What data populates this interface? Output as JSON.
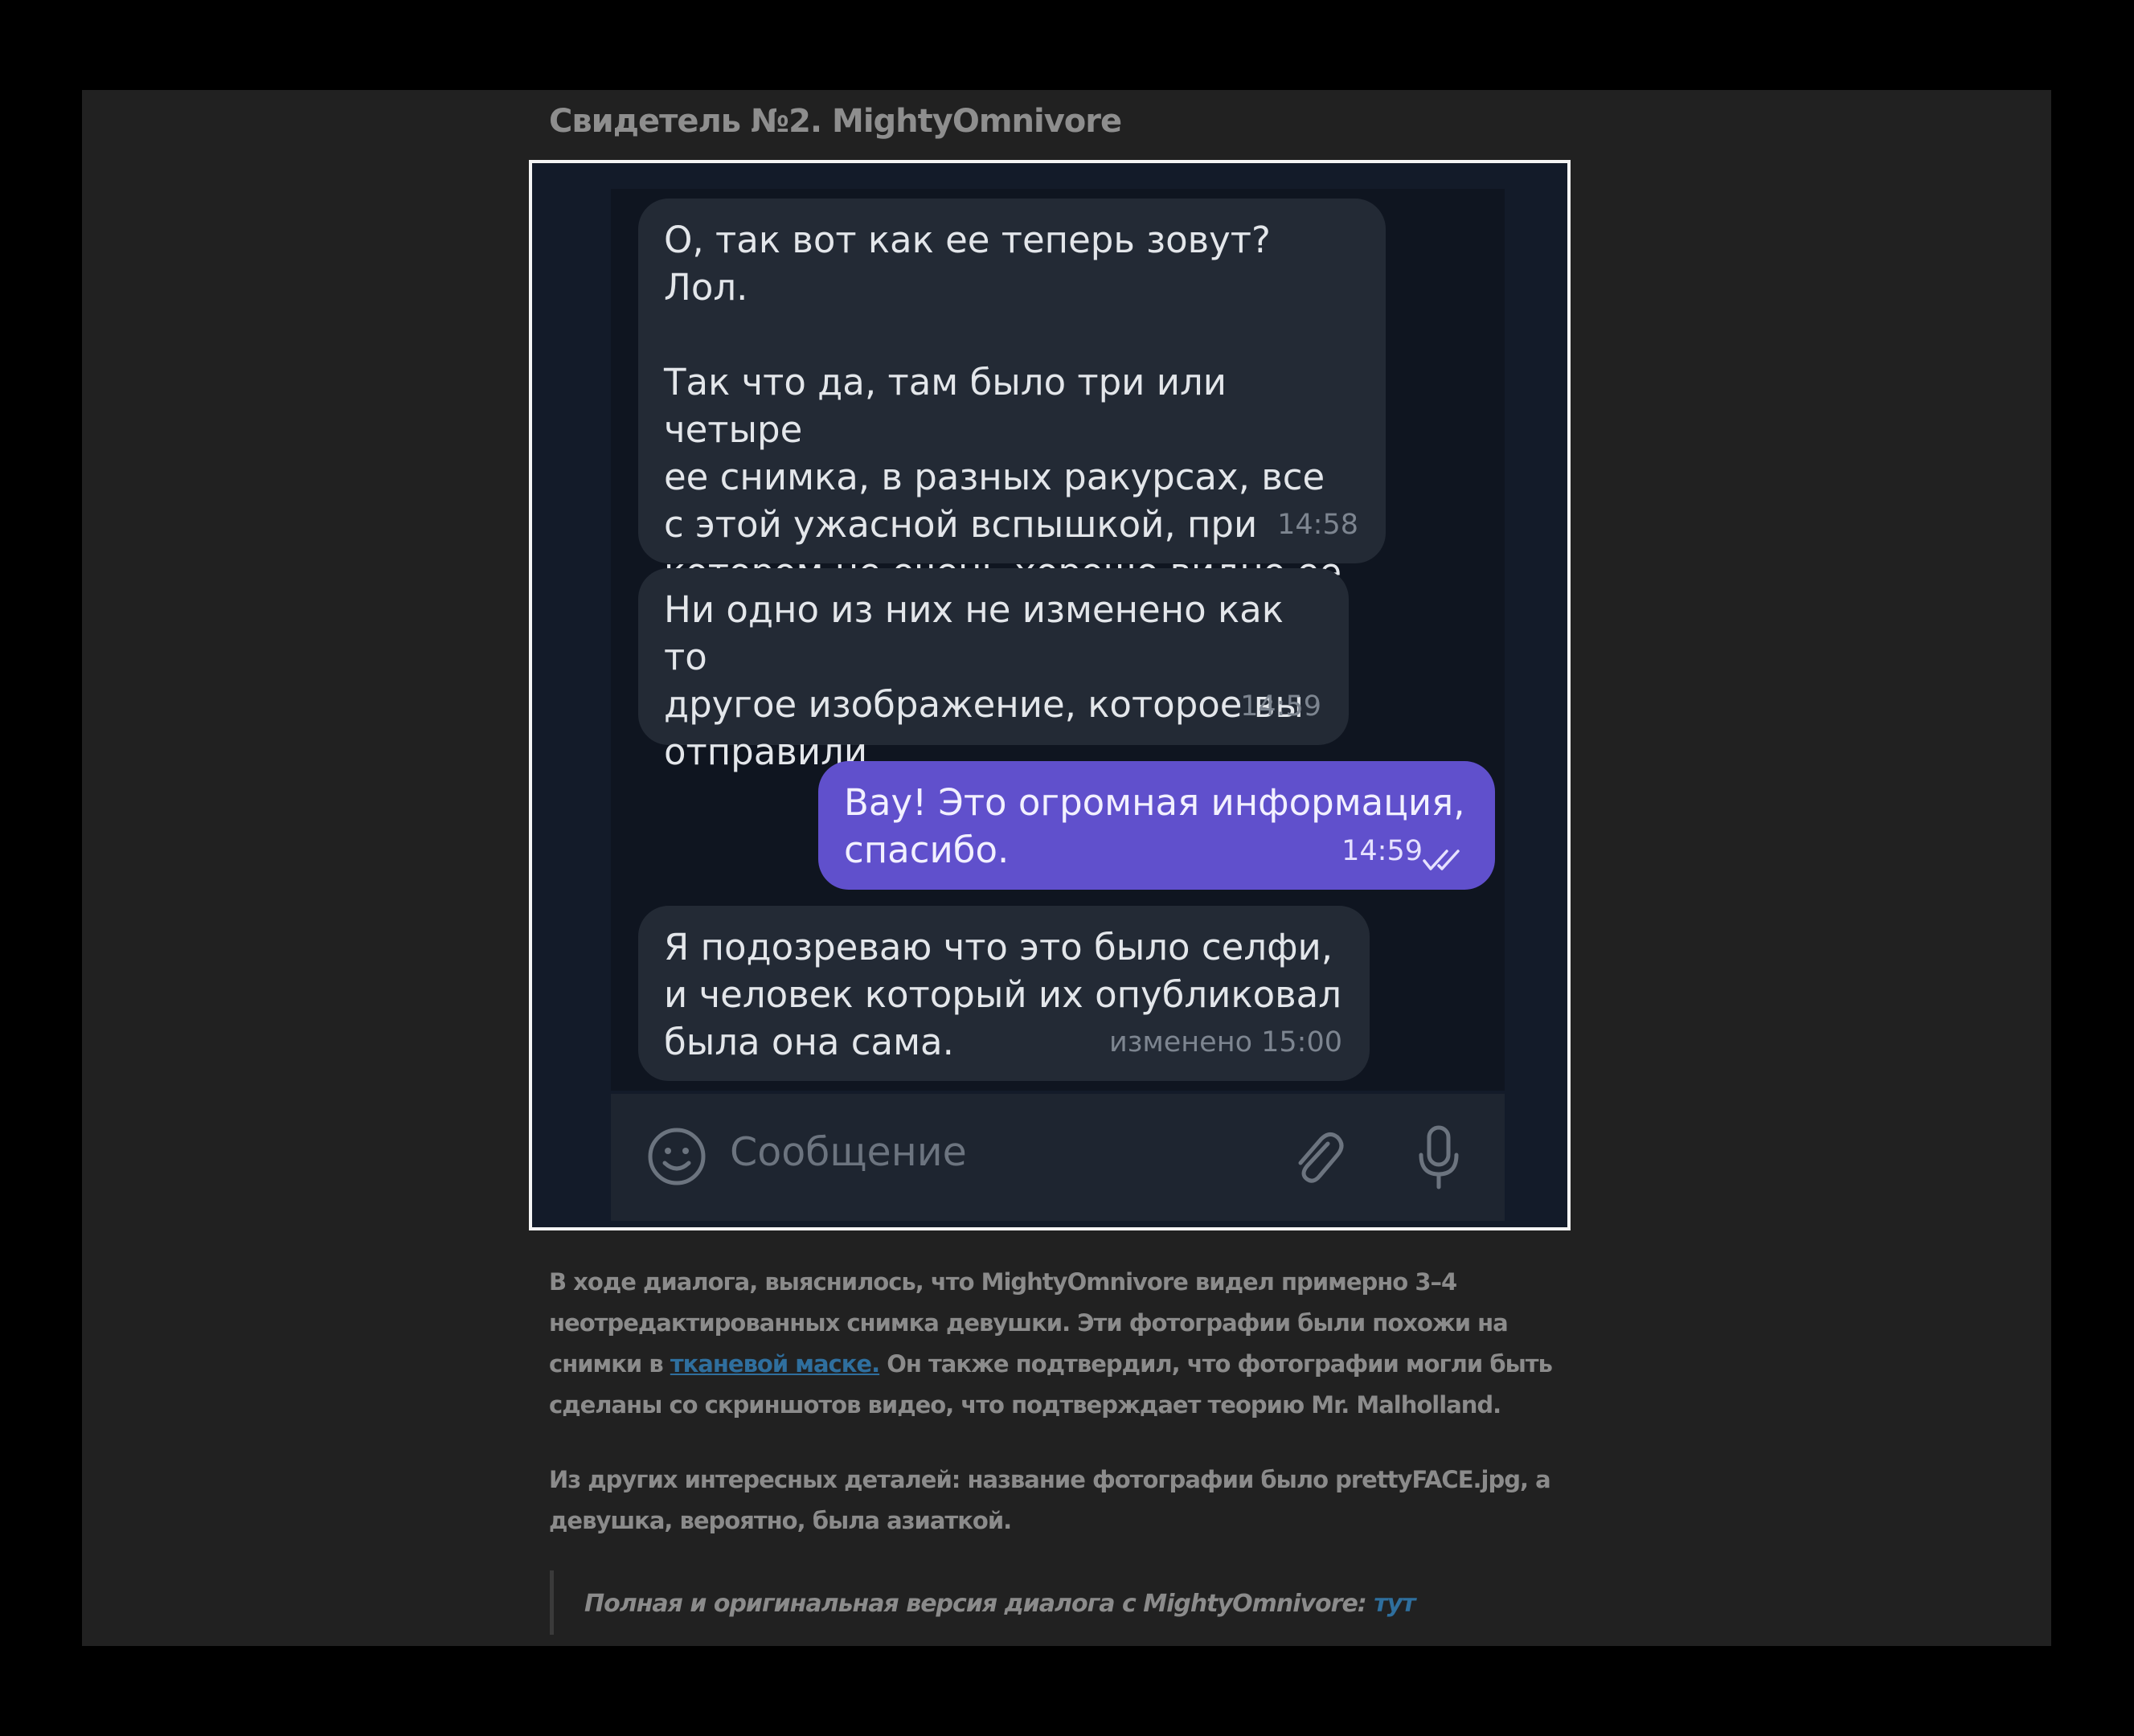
{
  "heading": "Свидетель №2. MightyOmnivore",
  "chat": {
    "messages": [
      {
        "text": "О, так вот как ее теперь зовут? Лол.\n\nТак что да, там было три или четыре\nее снимка, в разных ракурсах, все\nс этой ужасной вспышкой, при\nкотором не очень хорошо видно ее\nлицо.",
        "time": "14:58"
      },
      {
        "text": "Ни одно из них не изменено как то\nдругое изображение, которое вы\nотправили",
        "time": "14:59"
      },
      {
        "text": "Вау! Это огромная информация,\nспасибо.",
        "time": "14:59"
      },
      {
        "text": "Я подозреваю что это было селфи,\nи человек который их опубликовал\nбыла она сама.",
        "time": "изменено 15:00"
      }
    ],
    "input_placeholder": "Сообщение"
  },
  "article": {
    "p1_part1": "В ходе диалога, выяснилось, что MightyOmnivore видел примерно 3–4 неотредактированных снимка девушки. Эти фотографии были похожи на снимки в ",
    "p1_link": "тканевой маске.",
    "p1_part2": " Он также подтвердил, что фотографии могли быть сделаны со скриншотов видео, что подтверждает теорию Mr. Malholland.",
    "p2": "Из других интересных деталей: название фотографии было prettyFACE.jpg, а девушка, вероятно, была азиаткой.",
    "quote_text": "Полная и оригинальная версия диалога с MightyOmnivore: ",
    "quote_link": "тут"
  },
  "colors": {
    "page_bg": "#212121",
    "chat_bg": "#0f1520",
    "incoming_bubble": "#232a35",
    "outgoing_bubble": "#6050cc",
    "link": "#2f6f9e"
  },
  "icons": [
    "emoji-icon",
    "attach-icon",
    "microphone-icon",
    "double-check-icon"
  ]
}
